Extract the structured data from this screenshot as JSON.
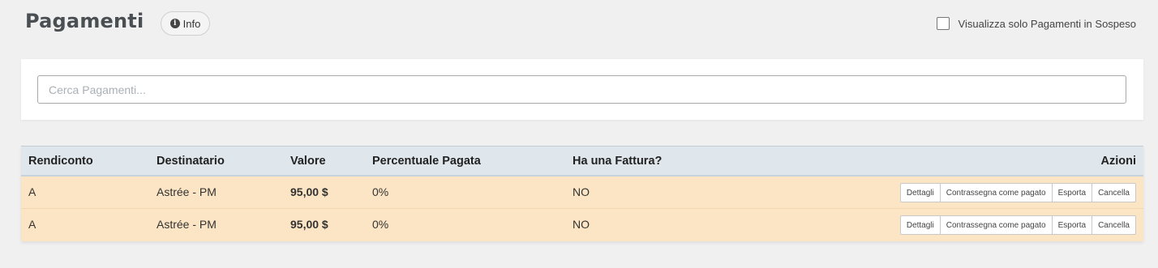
{
  "header": {
    "title": "Pagamenti",
    "info_label": "Info",
    "filter_label": "Visualizza solo Pagamenti in Sospeso",
    "filter_checked": false
  },
  "search": {
    "placeholder": "Cerca Pagamenti...",
    "value": ""
  },
  "table": {
    "columns": [
      "Rendiconto",
      "Destinatario",
      "Valore",
      "Percentuale Pagata",
      "Ha una Fattura?",
      "Azioni"
    ],
    "rows": [
      {
        "rendiconto": "A",
        "destinatario": "Astrée - PM",
        "valore": "95,00 $",
        "percentuale": "0%",
        "fattura": "NO",
        "actions": [
          "Dettagli",
          "Contrassegna come pagato",
          "Esporta",
          "Cancella"
        ]
      },
      {
        "rendiconto": "A",
        "destinatario": "Astrée - PM",
        "valore": "95,00 $",
        "percentuale": "0%",
        "fattura": "NO",
        "actions": [
          "Dettagli",
          "Contrassegna come pagato",
          "Esporta",
          "Cancella"
        ]
      }
    ]
  },
  "colors": {
    "background": "#f0f0f0",
    "header_row": "#e0e7ec",
    "data_row": "#fbe5c4",
    "title": "#4a4f54"
  }
}
